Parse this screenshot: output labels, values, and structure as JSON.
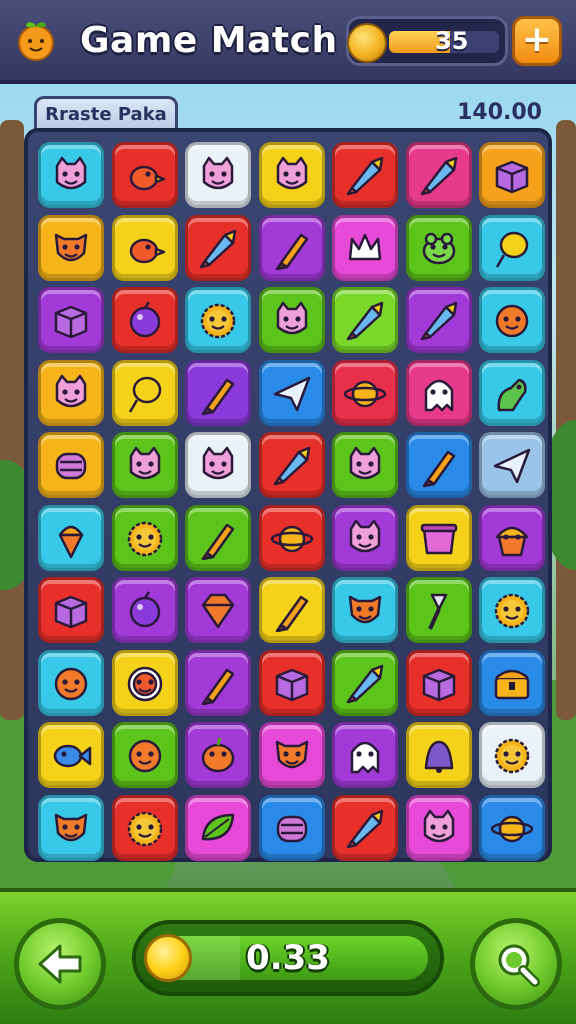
{
  "header": {
    "title": "Game Match",
    "coin_count": "35",
    "coin_fill": 0.55,
    "logo_icon": "orange-fruit-icon",
    "add_icon": "plus-icon"
  },
  "board": {
    "tab_label": "Rraste Paka",
    "score": "140.00",
    "rows": [
      [
        {
          "c": "#38c8e8",
          "i": "cat-face-icon"
        },
        {
          "c": "#e8302a",
          "i": "bird-icon"
        },
        {
          "c": "#e9f2f7",
          "i": "cat-face-icon"
        },
        {
          "c": "#f5d21a",
          "i": "cat-face-icon"
        },
        {
          "c": "#e8302a",
          "i": "rocket-icon"
        },
        {
          "c": "#e83a8a",
          "i": "rocket-icon"
        },
        {
          "c": "#f5a21a",
          "i": "box-icon"
        }
      ],
      [
        {
          "c": "#f5b51a",
          "i": "fox-face-icon"
        },
        {
          "c": "#f5d21a",
          "i": "bird-icon"
        },
        {
          "c": "#e8302a",
          "i": "rocket-icon"
        },
        {
          "c": "#a23ad8",
          "i": "brush-icon"
        },
        {
          "c": "#e84ad8",
          "i": "crown-icon"
        },
        {
          "c": "#5cc41a",
          "i": "frog-face-icon"
        },
        {
          "c": "#38c8e8",
          "i": "balloon-icon"
        }
      ],
      [
        {
          "c": "#a23ad8",
          "i": "box-icon"
        },
        {
          "c": "#e8302a",
          "i": "orb-icon"
        },
        {
          "c": "#38c8e8",
          "i": "sun-face-icon"
        },
        {
          "c": "#5cc41a",
          "i": "cat-face-icon"
        },
        {
          "c": "#7ad82a",
          "i": "rocket-icon"
        },
        {
          "c": "#a23ad8",
          "i": "rocket-icon"
        },
        {
          "c": "#38c8e8",
          "i": "smiley-icon"
        }
      ],
      [
        {
          "c": "#f5b51a",
          "i": "cat-face-icon"
        },
        {
          "c": "#f5d21a",
          "i": "balloon-icon"
        },
        {
          "c": "#8a3ad8",
          "i": "brush-icon"
        },
        {
          "c": "#2a8ae8",
          "i": "paper-plane-icon"
        },
        {
          "c": "#e8304a",
          "i": "planet-icon"
        },
        {
          "c": "#e83a8a",
          "i": "ghost-icon"
        },
        {
          "c": "#38c8e8",
          "i": "dino-icon"
        }
      ],
      [
        {
          "c": "#f5b51a",
          "i": "barrel-icon"
        },
        {
          "c": "#5cc41a",
          "i": "cat-face-icon"
        },
        {
          "c": "#e9f2f7",
          "i": "cat-face-icon"
        },
        {
          "c": "#e8302a",
          "i": "rocket-icon"
        },
        {
          "c": "#5cc41a",
          "i": "cat-face-icon"
        },
        {
          "c": "#2a8ae8",
          "i": "brush-icon"
        },
        {
          "c": "#9ac4e8",
          "i": "paper-plane-icon"
        }
      ],
      [
        {
          "c": "#38c8e8",
          "i": "ice-cream-icon"
        },
        {
          "c": "#5cc41a",
          "i": "sun-face-icon"
        },
        {
          "c": "#5cc41a",
          "i": "brush-icon"
        },
        {
          "c": "#e8302a",
          "i": "planet-icon"
        },
        {
          "c": "#a23ad8",
          "i": "cat-face-icon"
        },
        {
          "c": "#f5d21a",
          "i": "pot-icon"
        },
        {
          "c": "#a23ad8",
          "i": "cupcake-icon"
        }
      ],
      [
        {
          "c": "#e8302a",
          "i": "box-icon"
        },
        {
          "c": "#a23ad8",
          "i": "orb-icon"
        },
        {
          "c": "#a23ad8",
          "i": "gem-icon"
        },
        {
          "c": "#f5d21a",
          "i": "brush-icon"
        },
        {
          "c": "#38c8e8",
          "i": "fox-face-icon"
        },
        {
          "c": "#5cc41a",
          "i": "shovel-icon"
        },
        {
          "c": "#38c8e8",
          "i": "sun-face-icon"
        }
      ],
      [
        {
          "c": "#38c8e8",
          "i": "smiley-icon"
        },
        {
          "c": "#f5d21a",
          "i": "ring-face-icon"
        },
        {
          "c": "#a23ad8",
          "i": "brush-icon"
        },
        {
          "c": "#e8302a",
          "i": "box-icon"
        },
        {
          "c": "#5cc41a",
          "i": "rocket-icon"
        },
        {
          "c": "#e8302a",
          "i": "box-icon"
        },
        {
          "c": "#2a8ae8",
          "i": "chest-icon"
        }
      ],
      [
        {
          "c": "#f5d21a",
          "i": "fish-icon"
        },
        {
          "c": "#5cc41a",
          "i": "smiley-icon"
        },
        {
          "c": "#a23ad8",
          "i": "pumpkin-icon"
        },
        {
          "c": "#e84ad8",
          "i": "fox-face-icon"
        },
        {
          "c": "#a23ad8",
          "i": "ghost-icon"
        },
        {
          "c": "#f5d21a",
          "i": "bell-icon"
        },
        {
          "c": "#e9f2f7",
          "i": "sun-face-icon"
        }
      ],
      [
        {
          "c": "#38c8e8",
          "i": "fox-face-icon"
        },
        {
          "c": "#e8302a",
          "i": "sun-face-icon"
        },
        {
          "c": "#e84ad8",
          "i": "leaf-icon"
        },
        {
          "c": "#2a8ae8",
          "i": "barrel-icon"
        },
        {
          "c": "#e8302a",
          "i": "rocket-icon"
        },
        {
          "c": "#e84ad8",
          "i": "cat-face-icon"
        },
        {
          "c": "#2a8ae8",
          "i": "planet-icon"
        }
      ]
    ]
  },
  "footer": {
    "back_icon": "arrow-left-icon",
    "search_icon": "magnifier-icon",
    "progress_value": "0.33",
    "progress_fill": 0.33
  }
}
